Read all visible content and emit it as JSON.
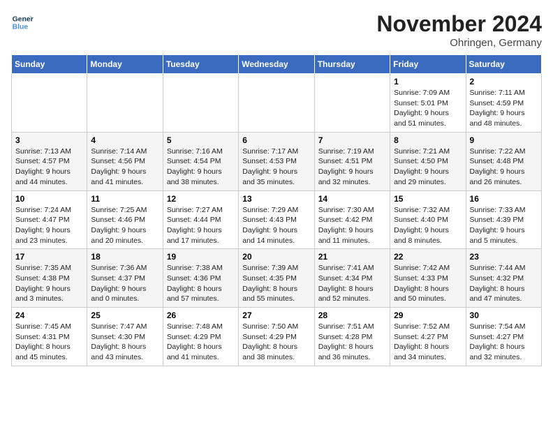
{
  "header": {
    "logo_line1": "General",
    "logo_line2": "Blue",
    "month_title": "November 2024",
    "subtitle": "Ohringen, Germany"
  },
  "weekdays": [
    "Sunday",
    "Monday",
    "Tuesday",
    "Wednesday",
    "Thursday",
    "Friday",
    "Saturday"
  ],
  "weeks": [
    [
      {
        "day": "",
        "info": ""
      },
      {
        "day": "",
        "info": ""
      },
      {
        "day": "",
        "info": ""
      },
      {
        "day": "",
        "info": ""
      },
      {
        "day": "",
        "info": ""
      },
      {
        "day": "1",
        "info": "Sunrise: 7:09 AM\nSunset: 5:01 PM\nDaylight: 9 hours and 51 minutes."
      },
      {
        "day": "2",
        "info": "Sunrise: 7:11 AM\nSunset: 4:59 PM\nDaylight: 9 hours and 48 minutes."
      }
    ],
    [
      {
        "day": "3",
        "info": "Sunrise: 7:13 AM\nSunset: 4:57 PM\nDaylight: 9 hours and 44 minutes."
      },
      {
        "day": "4",
        "info": "Sunrise: 7:14 AM\nSunset: 4:56 PM\nDaylight: 9 hours and 41 minutes."
      },
      {
        "day": "5",
        "info": "Sunrise: 7:16 AM\nSunset: 4:54 PM\nDaylight: 9 hours and 38 minutes."
      },
      {
        "day": "6",
        "info": "Sunrise: 7:17 AM\nSunset: 4:53 PM\nDaylight: 9 hours and 35 minutes."
      },
      {
        "day": "7",
        "info": "Sunrise: 7:19 AM\nSunset: 4:51 PM\nDaylight: 9 hours and 32 minutes."
      },
      {
        "day": "8",
        "info": "Sunrise: 7:21 AM\nSunset: 4:50 PM\nDaylight: 9 hours and 29 minutes."
      },
      {
        "day": "9",
        "info": "Sunrise: 7:22 AM\nSunset: 4:48 PM\nDaylight: 9 hours and 26 minutes."
      }
    ],
    [
      {
        "day": "10",
        "info": "Sunrise: 7:24 AM\nSunset: 4:47 PM\nDaylight: 9 hours and 23 minutes."
      },
      {
        "day": "11",
        "info": "Sunrise: 7:25 AM\nSunset: 4:46 PM\nDaylight: 9 hours and 20 minutes."
      },
      {
        "day": "12",
        "info": "Sunrise: 7:27 AM\nSunset: 4:44 PM\nDaylight: 9 hours and 17 minutes."
      },
      {
        "day": "13",
        "info": "Sunrise: 7:29 AM\nSunset: 4:43 PM\nDaylight: 9 hours and 14 minutes."
      },
      {
        "day": "14",
        "info": "Sunrise: 7:30 AM\nSunset: 4:42 PM\nDaylight: 9 hours and 11 minutes."
      },
      {
        "day": "15",
        "info": "Sunrise: 7:32 AM\nSunset: 4:40 PM\nDaylight: 9 hours and 8 minutes."
      },
      {
        "day": "16",
        "info": "Sunrise: 7:33 AM\nSunset: 4:39 PM\nDaylight: 9 hours and 5 minutes."
      }
    ],
    [
      {
        "day": "17",
        "info": "Sunrise: 7:35 AM\nSunset: 4:38 PM\nDaylight: 9 hours and 3 minutes."
      },
      {
        "day": "18",
        "info": "Sunrise: 7:36 AM\nSunset: 4:37 PM\nDaylight: 9 hours and 0 minutes."
      },
      {
        "day": "19",
        "info": "Sunrise: 7:38 AM\nSunset: 4:36 PM\nDaylight: 8 hours and 57 minutes."
      },
      {
        "day": "20",
        "info": "Sunrise: 7:39 AM\nSunset: 4:35 PM\nDaylight: 8 hours and 55 minutes."
      },
      {
        "day": "21",
        "info": "Sunrise: 7:41 AM\nSunset: 4:34 PM\nDaylight: 8 hours and 52 minutes."
      },
      {
        "day": "22",
        "info": "Sunrise: 7:42 AM\nSunset: 4:33 PM\nDaylight: 8 hours and 50 minutes."
      },
      {
        "day": "23",
        "info": "Sunrise: 7:44 AM\nSunset: 4:32 PM\nDaylight: 8 hours and 47 minutes."
      }
    ],
    [
      {
        "day": "24",
        "info": "Sunrise: 7:45 AM\nSunset: 4:31 PM\nDaylight: 8 hours and 45 minutes."
      },
      {
        "day": "25",
        "info": "Sunrise: 7:47 AM\nSunset: 4:30 PM\nDaylight: 8 hours and 43 minutes."
      },
      {
        "day": "26",
        "info": "Sunrise: 7:48 AM\nSunset: 4:29 PM\nDaylight: 8 hours and 41 minutes."
      },
      {
        "day": "27",
        "info": "Sunrise: 7:50 AM\nSunset: 4:29 PM\nDaylight: 8 hours and 38 minutes."
      },
      {
        "day": "28",
        "info": "Sunrise: 7:51 AM\nSunset: 4:28 PM\nDaylight: 8 hours and 36 minutes."
      },
      {
        "day": "29",
        "info": "Sunrise: 7:52 AM\nSunset: 4:27 PM\nDaylight: 8 hours and 34 minutes."
      },
      {
        "day": "30",
        "info": "Sunrise: 7:54 AM\nSunset: 4:27 PM\nDaylight: 8 hours and 32 minutes."
      }
    ]
  ]
}
